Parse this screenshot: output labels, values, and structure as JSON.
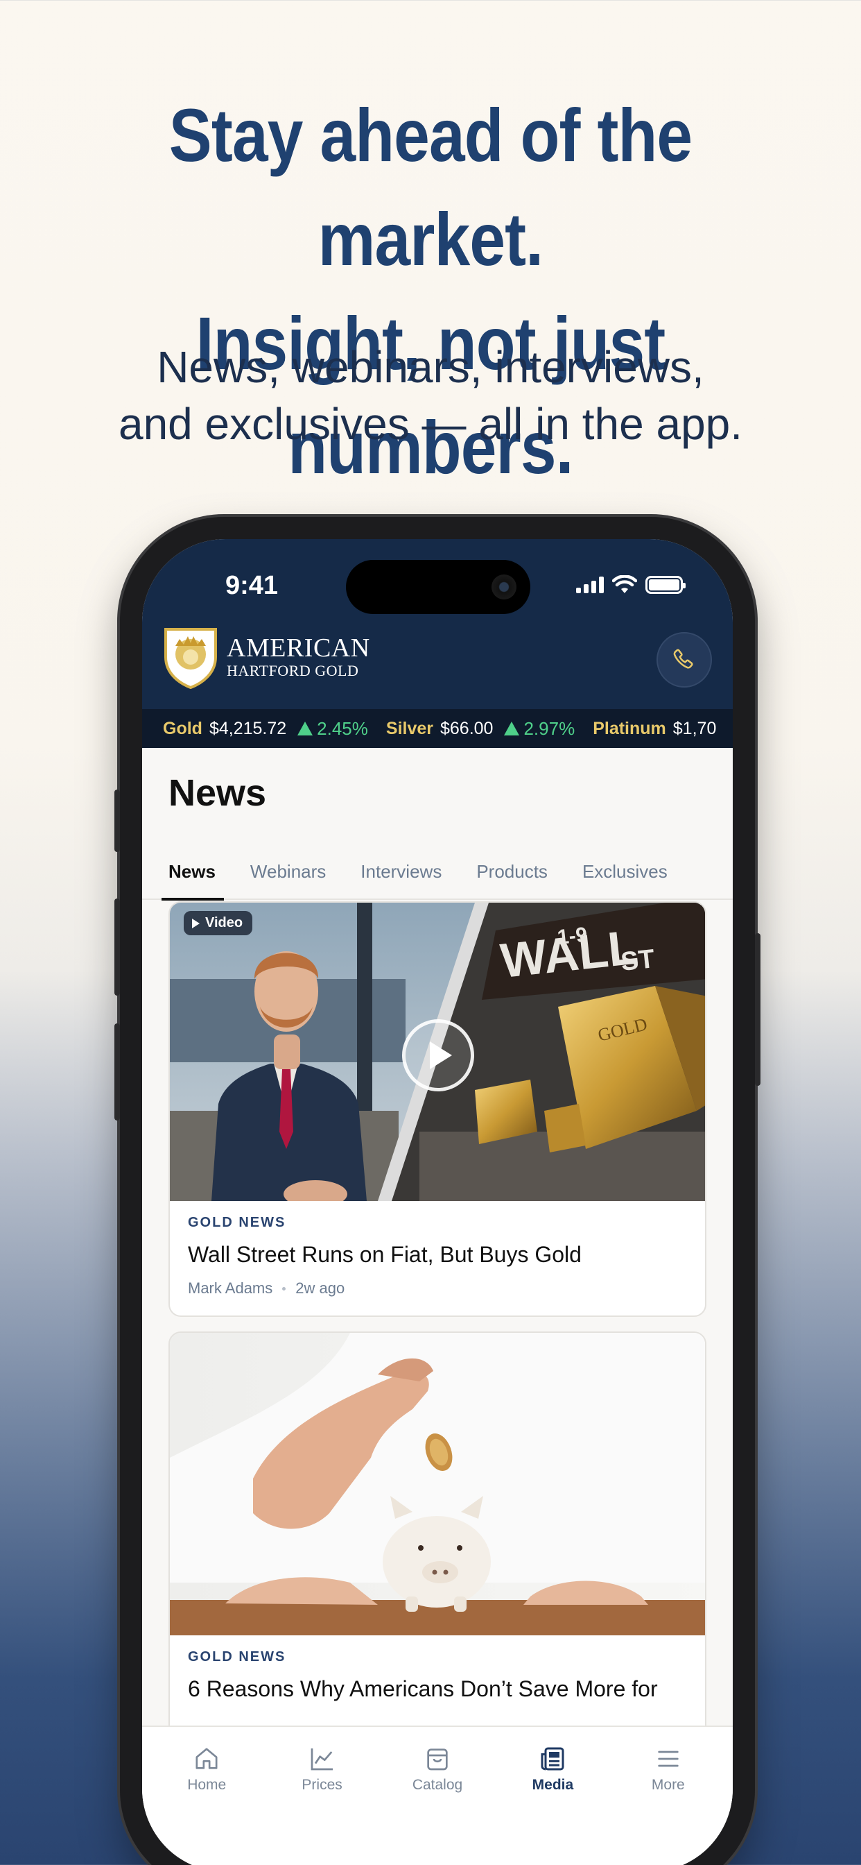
{
  "hero": {
    "title_line1": "Stay ahead of the market.",
    "title_line2": "Insight, not just numbers.",
    "subtitle_line1": "News, webinars, interviews,",
    "subtitle_line2": "and exclusives — all in the app."
  },
  "status_bar": {
    "time": "9:41"
  },
  "brand": {
    "line1": "AMERICAN",
    "line2": "HARTFORD GOLD"
  },
  "ticker": [
    {
      "name": "Gold",
      "price": "$4,215.72",
      "change": "2.45%"
    },
    {
      "name": "Silver",
      "price": "$66.00",
      "change": "2.97%"
    },
    {
      "name": "Platinum",
      "price": "$1,70",
      "change": ""
    }
  ],
  "page": {
    "title": "News"
  },
  "tabs": [
    "News",
    "Webinars",
    "Interviews",
    "Products",
    "Exclusives"
  ],
  "articles": [
    {
      "badge": "Video",
      "category": "GOLD NEWS",
      "title": "Wall Street Runs on Fiat, But Buys Gold",
      "author": "Mark Adams",
      "age": "2w ago"
    },
    {
      "category": "GOLD NEWS",
      "title": "6 Reasons Why Americans Don’t Save More for"
    }
  ],
  "tabbar": [
    {
      "label": "Home",
      "icon": "home-icon"
    },
    {
      "label": "Prices",
      "icon": "chart-icon"
    },
    {
      "label": "Catalog",
      "icon": "bag-icon"
    },
    {
      "label": "Media",
      "icon": "newspaper-icon",
      "active": true
    },
    {
      "label": "More",
      "icon": "menu-icon"
    }
  ],
  "colors": {
    "headline": "#1f4170",
    "navy": "#152a48",
    "gold": "#e8c96a",
    "up": "#4fd08a"
  }
}
